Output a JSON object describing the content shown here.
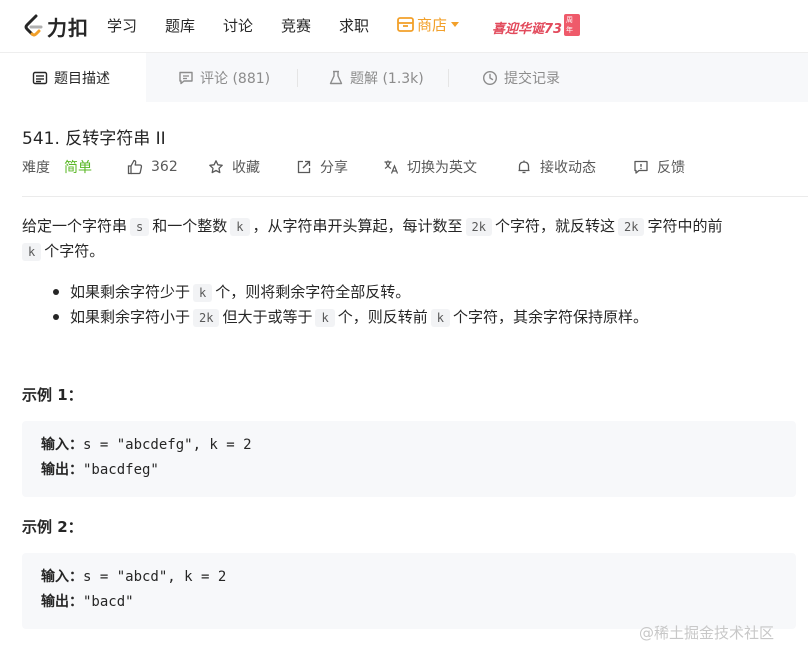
{
  "nav": {
    "logo_text": "力扣",
    "items": [
      "学习",
      "题库",
      "讨论",
      "竞赛",
      "求职"
    ],
    "shop_label": "商店",
    "promo_text": "喜迎华诞73",
    "promo_badge": "周年"
  },
  "tabs": [
    {
      "label": "题目描述",
      "active": true
    },
    {
      "label": "评论 (881)",
      "active": false
    },
    {
      "label": "题解 (1.3k)",
      "active": false
    },
    {
      "label": "提交记录",
      "active": false
    }
  ],
  "problem": {
    "title": "541. 反转字符串 II",
    "difficulty_label": "难度",
    "difficulty": "简单",
    "likes": "362",
    "favorite_label": "收藏",
    "share_label": "分享",
    "switch_lang_label": "切换为英文",
    "subscribe_label": "接收动态",
    "feedback_label": "反馈"
  },
  "description": {
    "p1_a": "给定一个字符串",
    "p1_s": "s",
    "p1_b": "和一个整数",
    "p1_k": "k",
    "p1_c": "，从字符串开头算起，每计数至",
    "p1_2k": "2k",
    "p1_d": "个字符，就反转这",
    "p1_2k_b": "2k",
    "p1_e": "字符中的前",
    "p1_k2": "k",
    "p1_f": "个字符。",
    "b1_a": "如果剩余字符少于",
    "b1_k": "k",
    "b1_b": "个，则将剩余字符全部反转。",
    "b2_a": "如果剩余字符小于",
    "b2_2k": "2k",
    "b2_b": "但大于或等于",
    "b2_k": "k",
    "b2_c": "个，则反转前",
    "b2_k2": "k",
    "b2_d": "个字符，其余字符保持原样。"
  },
  "examples": [
    {
      "heading": "示例 1：",
      "input_label": "输入：",
      "input": "s = \"abcdefg\", k = 2",
      "output_label": "输出：",
      "output": "\"bacdfeg\""
    },
    {
      "heading": "示例 2：",
      "input_label": "输入：",
      "input": "s = \"abcd\", k = 2",
      "output_label": "输出：",
      "output": "\"bacd\""
    }
  ],
  "watermark": "@稀土掘金技术社区",
  "colors": {
    "accent_green": "#5ab726",
    "shop_orange": "#f2a02a",
    "promo_red": "#e24a5c"
  }
}
